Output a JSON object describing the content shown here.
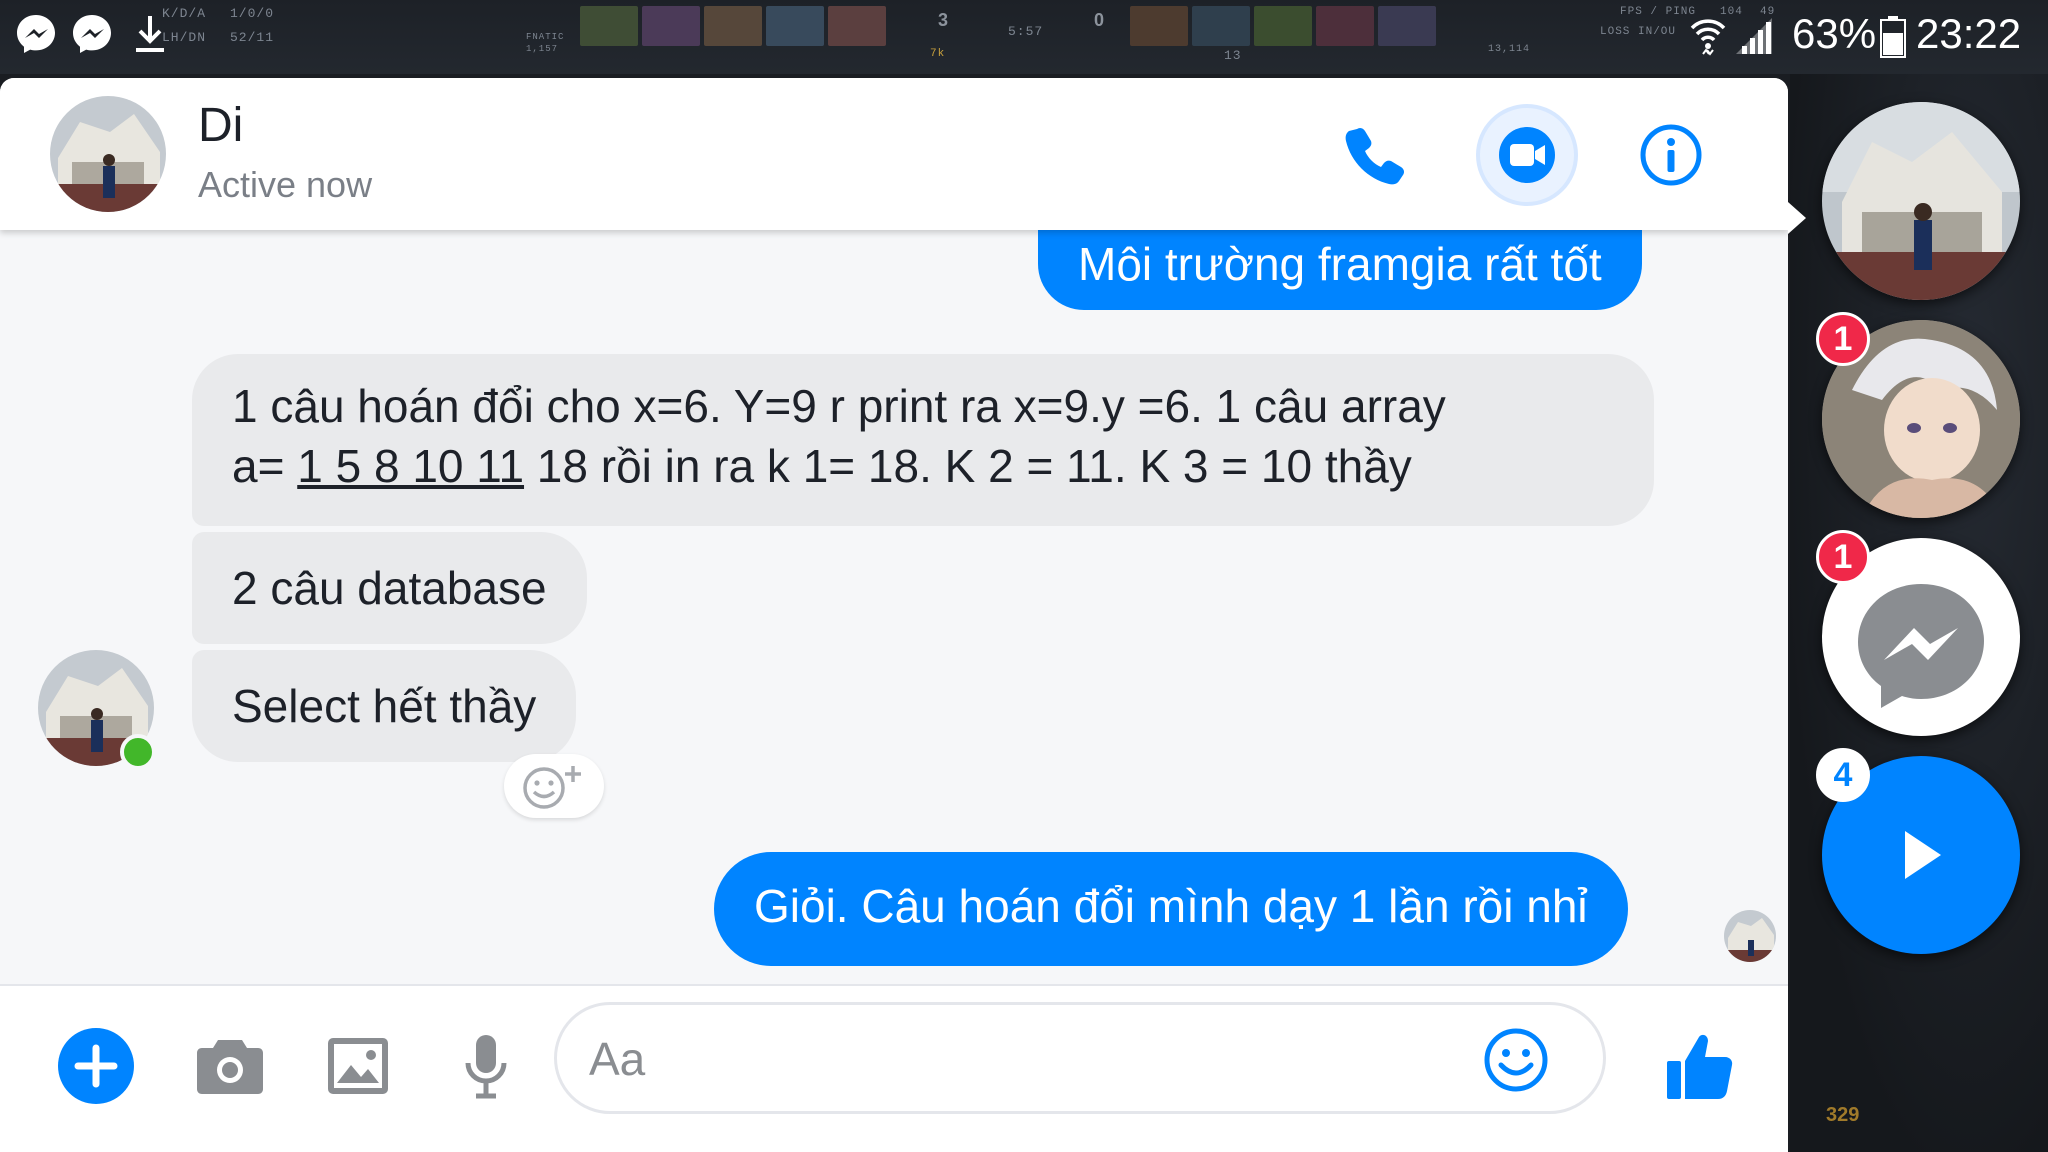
{
  "status_bar": {
    "battery": "63%",
    "time": "23:22",
    "game_overlay": {
      "kda_label": "K/D/A",
      "kda_value": "1/0/0",
      "lhdn_label": "LH/DN",
      "lhdn_value": "52/11",
      "team_label": "FNATIC",
      "team_value": "1,157",
      "radiant_score": "3",
      "clock": "5:57",
      "dire_score": "0",
      "lead": "7k",
      "left_net": "13",
      "right_net": "13,114",
      "fps_label": "FPS / PING",
      "loss_label": "LOSS IN/OU",
      "fps": "104",
      "ping": "49"
    }
  },
  "colors": {
    "accent": "#0084ff",
    "incoming": "#e9eaec",
    "badge": "#f02849",
    "online": "#42b72a"
  },
  "header": {
    "name": "Di",
    "status": "Active now",
    "call_icon": "phone-icon",
    "video_icon": "video-camera-icon",
    "info_icon": "info-icon"
  },
  "messages": [
    {
      "dir": "out",
      "text": "Môi trường framgia rất tốt"
    },
    {
      "dir": "in",
      "line1": "1 câu hoán đổi cho x=6. Y=9 r print ra x=9.y =6. 1 câu array",
      "line2_pre": "a= ",
      "line2_link": "1 5 8 10 11",
      "line2_post": " 18 rồi in ra k 1= 18. K 2 = 11. K 3 = 10 thầy"
    },
    {
      "dir": "in",
      "text": "2 câu database"
    },
    {
      "dir": "in",
      "text": "Select hết thầy"
    },
    {
      "dir": "out",
      "text": "Giỏi. Câu hoán đổi mình dạy 1 lần rồi nhỉ"
    }
  ],
  "composer": {
    "placeholder": "Aa",
    "value": "",
    "icons": [
      "plus-icon",
      "camera-icon",
      "image-icon",
      "microphone-icon",
      "emoji-icon",
      "thumbs-up-icon"
    ]
  },
  "chat_heads": [
    {
      "name": "di-chat-head",
      "badge": ""
    },
    {
      "name": "anime-chat-head",
      "badge": "1"
    },
    {
      "name": "messenger-chat-head",
      "badge": "1"
    },
    {
      "name": "more-chat-heads",
      "badge": "4"
    }
  ],
  "hud": {
    "gold": "329"
  }
}
